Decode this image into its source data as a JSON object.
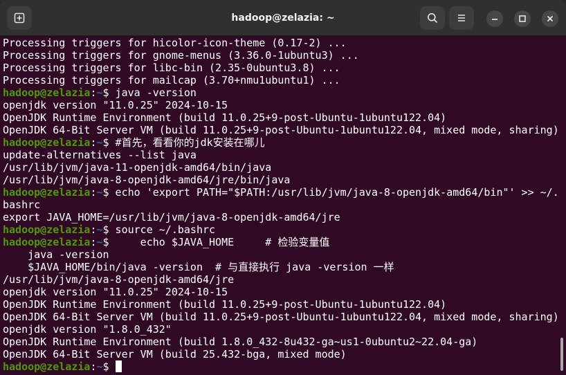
{
  "window": {
    "title": "hadoop@zelazia: ~",
    "icons": {
      "new_tab": "new-tab-icon",
      "search": "search-icon",
      "menu": "hamburger-menu-icon",
      "minimize": "minimize-icon",
      "maximize": "maximize-icon",
      "close": "close-icon"
    }
  },
  "colors": {
    "background": "#300a24",
    "user": "#4e9a06",
    "path": "#3465a4",
    "text": "#ffffff"
  },
  "terminal": {
    "lines": [
      {
        "type": "out",
        "text": "Processing triggers for hicolor-icon-theme (0.17-2) ..."
      },
      {
        "type": "out",
        "text": "Processing triggers for gnome-menus (3.36.0-1ubuntu3) ..."
      },
      {
        "type": "out",
        "text": "Processing triggers for libc-bin (2.35-0ubuntu3.8) ..."
      },
      {
        "type": "out",
        "text": "Processing triggers for mailcap (3.70+nmu1ubuntu1) ..."
      },
      {
        "type": "prompt",
        "user": "hadoop@zelazia",
        "path": "~",
        "symbol": "$",
        "cmd": " java -version"
      },
      {
        "type": "out",
        "text": "openjdk version \"11.0.25\" 2024-10-15"
      },
      {
        "type": "out",
        "text": "OpenJDK Runtime Environment (build 11.0.25+9-post-Ubuntu-1ubuntu122.04)"
      },
      {
        "type": "out",
        "text": "OpenJDK 64-Bit Server VM (build 11.0.25+9-post-Ubuntu-1ubuntu122.04, mixed mode, sharing)"
      },
      {
        "type": "prompt",
        "user": "hadoop@zelazia",
        "path": "~",
        "symbol": "$",
        "cmd": " #首先，看看你的jdk安装在哪儿"
      },
      {
        "type": "out",
        "text": "update-alternatives --list java"
      },
      {
        "type": "out",
        "text": "/usr/lib/jvm/java-11-openjdk-amd64/bin/java"
      },
      {
        "type": "out",
        "text": "/usr/lib/jvm/java-8-openjdk-amd64/jre/bin/java"
      },
      {
        "type": "prompt",
        "user": "hadoop@zelazia",
        "path": "~",
        "symbol": "$",
        "cmd": " echo 'export PATH=\"$PATH:/usr/lib/jvm/java-8-openjdk-amd64/bin\"' >> ~/."
      },
      {
        "type": "out",
        "text": "bashrc"
      },
      {
        "type": "out",
        "text": "export JAVA_HOME=/usr/lib/jvm/java-8-openjdk-amd64/jre"
      },
      {
        "type": "prompt",
        "user": "hadoop@zelazia",
        "path": "~",
        "symbol": "$",
        "cmd": " source ~/.bashrc"
      },
      {
        "type": "prompt",
        "user": "hadoop@zelazia",
        "path": "~",
        "symbol": "$",
        "cmd": "     echo $JAVA_HOME     # 检验变量值"
      },
      {
        "type": "out",
        "text": "    java -version"
      },
      {
        "type": "out",
        "text": "    $JAVA_HOME/bin/java -version  # 与直接执行 java -version 一样"
      },
      {
        "type": "out",
        "text": "/usr/lib/jvm/java-8-openjdk-amd64/jre"
      },
      {
        "type": "out",
        "text": "openjdk version \"11.0.25\" 2024-10-15"
      },
      {
        "type": "out",
        "text": "OpenJDK Runtime Environment (build 11.0.25+9-post-Ubuntu-1ubuntu122.04)"
      },
      {
        "type": "out",
        "text": "OpenJDK 64-Bit Server VM (build 11.0.25+9-post-Ubuntu-1ubuntu122.04, mixed mode, sharing)"
      },
      {
        "type": "out",
        "text": "openjdk version \"1.8.0_432\""
      },
      {
        "type": "out",
        "text": "OpenJDK Runtime Environment (build 1.8.0_432-8u432-ga~us1-0ubuntu2~22.04-ga)"
      },
      {
        "type": "out",
        "text": "OpenJDK 64-Bit Server VM (build 25.432-bga, mixed mode)"
      },
      {
        "type": "prompt",
        "user": "hadoop@zelazia",
        "path": "~",
        "symbol": "$",
        "cmd": " ",
        "cursor": true
      }
    ]
  }
}
